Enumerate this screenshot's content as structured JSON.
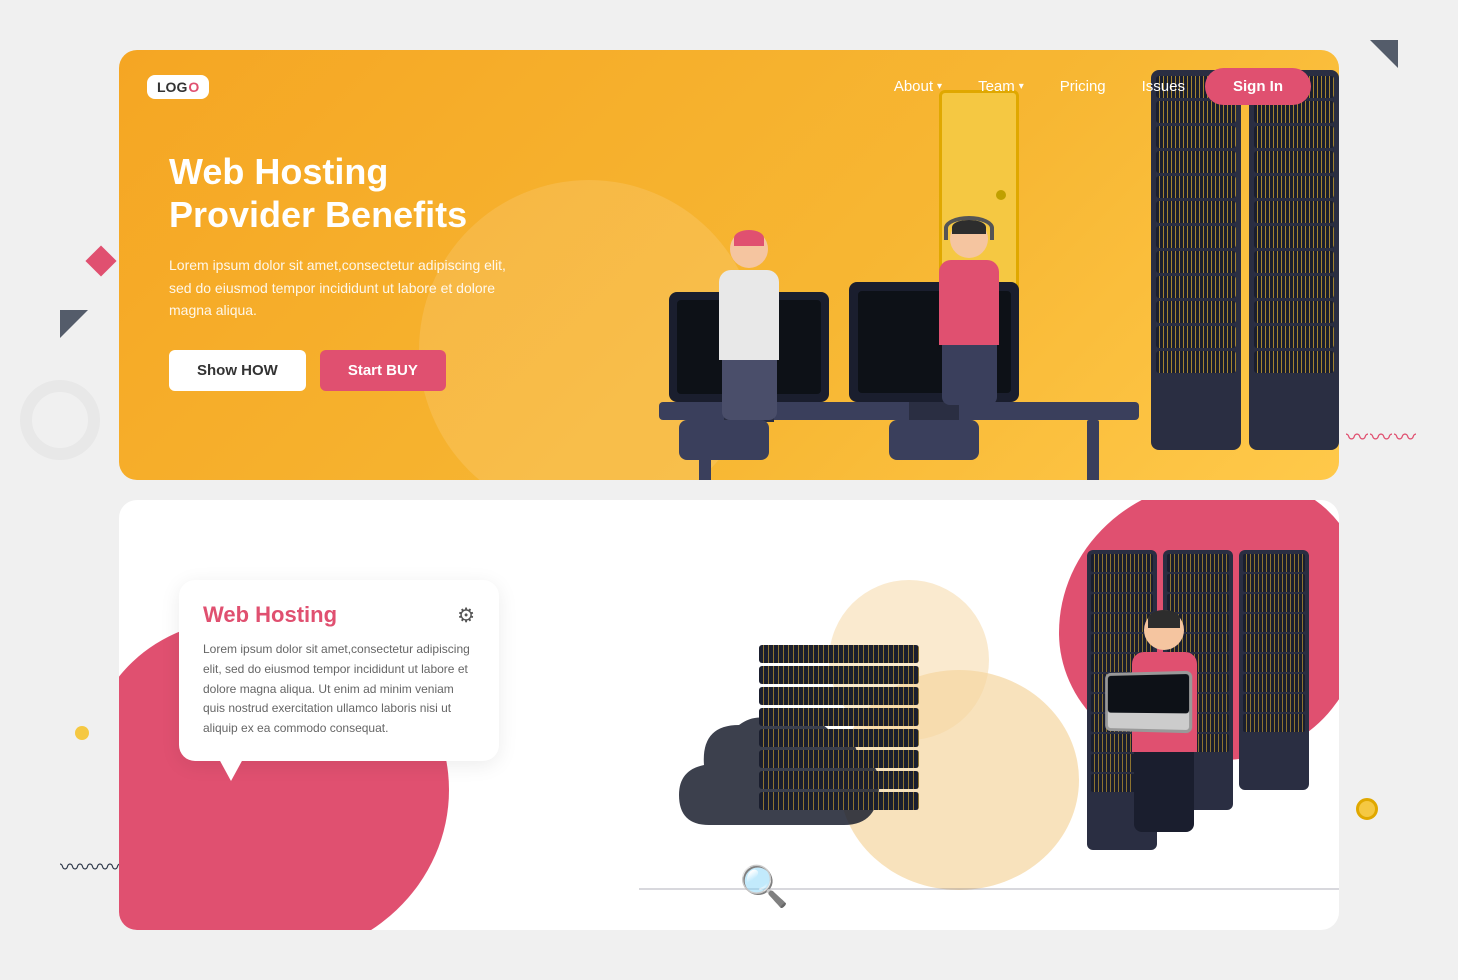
{
  "page": {
    "bg_color": "#f0f0f0"
  },
  "decorations": {
    "triangle_label": "triangle",
    "diamond_label": "diamond",
    "wave": "∿∿∿",
    "wave2": "∿∿∿"
  },
  "top_card": {
    "nav": {
      "logo": "LOG",
      "logo_accent": "O",
      "links": [
        {
          "label": "About",
          "has_dropdown": true
        },
        {
          "label": "Team",
          "has_dropdown": true
        },
        {
          "label": "Pricing",
          "has_dropdown": false
        },
        {
          "label": "Issues",
          "has_dropdown": false
        }
      ],
      "signin_label": "Sign In"
    },
    "hero": {
      "title_line1": "Web Hosting",
      "title_line2": "Provider Benefits",
      "description": "Lorem ipsum dolor sit amet,consectetur adipiscing elit, sed do eiusmod tempor incididunt ut labore et dolore magna aliqua.",
      "btn_show": "Show HOW",
      "btn_start": "Start BUY"
    }
  },
  "bottom_card": {
    "info_card": {
      "title": "Web Hosting",
      "description": "Lorem ipsum dolor sit amet,consectetur adipiscing elit, sed do eiusmod tempor incididunt ut labore et dolore magna aliqua. Ut enim ad minim veniam quis nostrud exercitation ullamco laboris nisi ut aliquip ex ea commodo consequat.",
      "icon": "⚙"
    }
  }
}
